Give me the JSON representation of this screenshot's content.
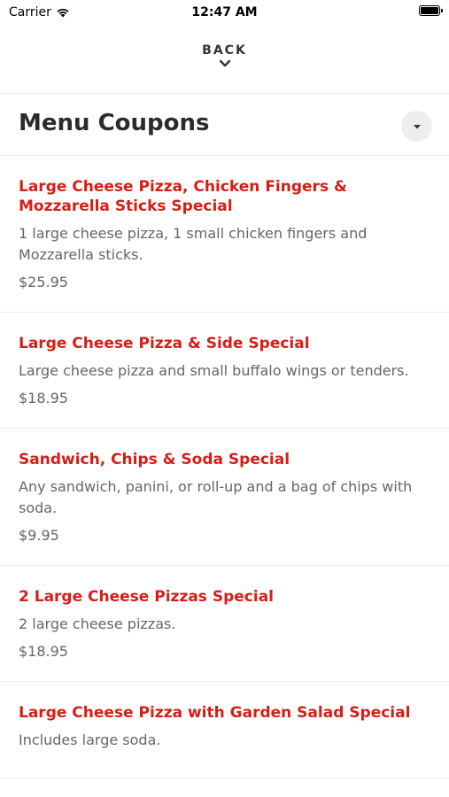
{
  "status_bar": {
    "carrier": "Carrier",
    "time": "12:47 AM"
  },
  "nav": {
    "back_label": "BACK"
  },
  "header": {
    "title": "Menu Coupons"
  },
  "coupons": [
    {
      "name": "Large Cheese Pizza, Chicken Fingers & Mozzarella Sticks Special",
      "description": "1 large cheese pizza, 1 small chicken fingers and Mozzarella sticks.",
      "price": "$25.95"
    },
    {
      "name": "Large Cheese Pizza & Side Special",
      "description": "Large cheese pizza and small buffalo wings or tenders.",
      "price": "$18.95"
    },
    {
      "name": "Sandwich, Chips & Soda Special",
      "description": "Any sandwich, panini, or roll-up and a bag of chips with soda.",
      "price": "$9.95"
    },
    {
      "name": "2 Large Cheese Pizzas Special",
      "description": "2 large cheese pizzas.",
      "price": "$18.95"
    },
    {
      "name": "Large Cheese Pizza with Garden Salad Special",
      "description": "Includes large soda.",
      "price": ""
    }
  ],
  "colors": {
    "accent": "#d51e16",
    "text_secondary": "#666666",
    "title": "#2b2b2b"
  },
  "icons": {
    "wifi": "wifi-icon",
    "battery": "battery-icon",
    "back": "chevron-down-icon",
    "dropdown": "caret-down-icon"
  }
}
